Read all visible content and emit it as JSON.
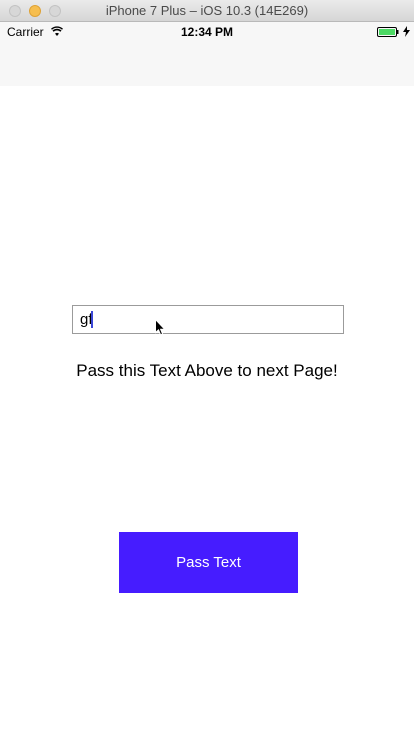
{
  "window": {
    "title": "iPhone 7 Plus – iOS 10.3 (14E269)"
  },
  "status_bar": {
    "carrier": "Carrier",
    "time": "12:34 PM",
    "icons": [
      "wifi-icon",
      "battery-icon",
      "charging-icon"
    ],
    "battery_color": "#4cd964"
  },
  "text_field": {
    "value": "gf"
  },
  "instruction_label": "Pass this Text Above to next Page!",
  "pass_button": {
    "label": "Pass Text",
    "color": "#461cff"
  }
}
